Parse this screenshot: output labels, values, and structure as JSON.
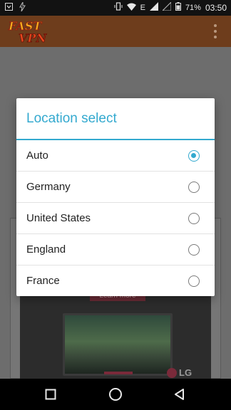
{
  "status_bar": {
    "network_type": "E",
    "battery": "71%",
    "time": "03:50"
  },
  "app": {
    "logo_text_top": "FAST",
    "logo_text_bottom": "VPN",
    "brand_color": "#6e3d1c"
  },
  "ad": {
    "cta_label": "Learn more",
    "brand": "LG"
  },
  "dialog": {
    "title": "Location select",
    "accent_color": "#33a9cf",
    "options": [
      {
        "label": "Auto",
        "selected": true
      },
      {
        "label": "Germany",
        "selected": false
      },
      {
        "label": "United States",
        "selected": false
      },
      {
        "label": "England",
        "selected": false
      },
      {
        "label": "France",
        "selected": false
      }
    ]
  },
  "nav": {
    "recents_icon": "square-icon",
    "home_icon": "circle-icon",
    "back_icon": "triangle-back-icon"
  }
}
